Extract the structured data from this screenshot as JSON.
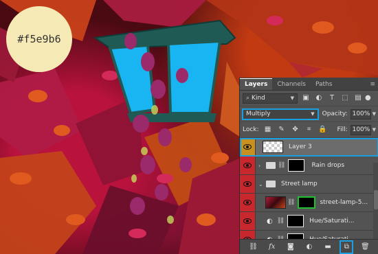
{
  "swatch": {
    "label": "#f5e9b6",
    "color": "#f5e9b6"
  },
  "panel": {
    "tabs": [
      "Layers",
      "Channels",
      "Paths"
    ],
    "filter_kind": "Kind",
    "blend_mode": "Multiply",
    "opacity_label": "Opacity:",
    "opacity_value": "100%",
    "lock_label": "Lock:",
    "fill_label": "Fill:",
    "fill_value": "100%",
    "layers": [
      {
        "name": "Layer 3",
        "selected": true
      },
      {
        "name": "Rain drops",
        "group": true
      },
      {
        "name": "Street lamp",
        "group": true,
        "open": true
      },
      {
        "name": "street-lamp-5..."
      },
      {
        "name": "Hue/Saturati..."
      },
      {
        "name": "Hue/Saturati..."
      }
    ]
  },
  "colors": {
    "accent": "#1aa0e0",
    "mask_highlight": "#21c231"
  }
}
